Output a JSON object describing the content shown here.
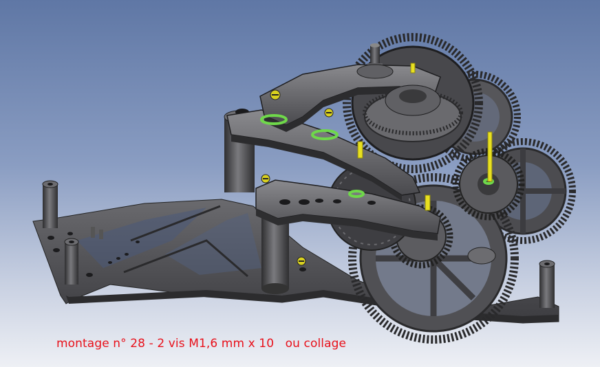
{
  "caption": "montage n° 28 - 2 vis M1,6 mm x 10   ou collage",
  "colors": {
    "background_top": "#5f77a5",
    "background_bottom": "#eef0f5",
    "part_dark": "#3a3a3c",
    "part_mid": "#5e5e62",
    "part_light": "#8c8c90",
    "screw_yellow": "#e8e020",
    "washer_green": "#6fd84a",
    "caption_red": "#e8101a"
  },
  "icons": [
    "gear-icon",
    "screw-icon",
    "pillar-icon"
  ]
}
